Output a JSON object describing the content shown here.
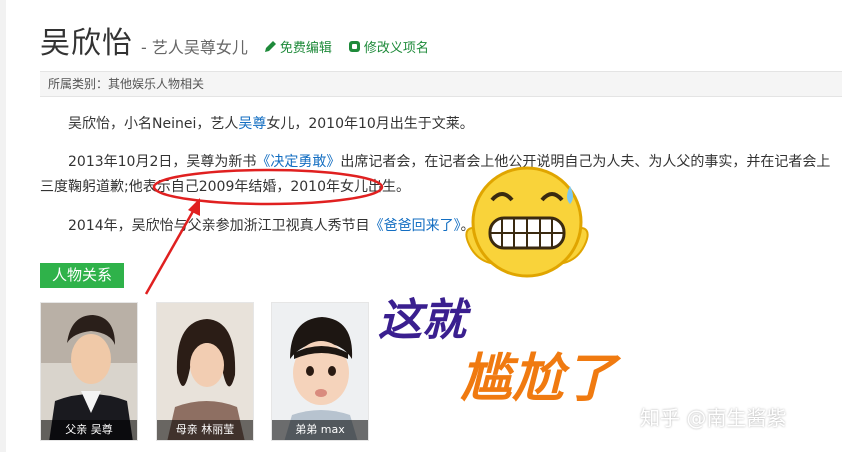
{
  "header": {
    "title": "吴欣怡",
    "subtitle": "- 艺人吴尊女儿",
    "edit_label": "免费编辑",
    "modify_label": "修改义项名"
  },
  "category": {
    "text": "所属类别：其他娱乐人物相关"
  },
  "paragraphs": {
    "p1": {
      "a": "吴欣怡，小名Neinei，艺人",
      "link": "吴尊",
      "b": "女儿，2010年10月出生于文莱。"
    },
    "p2": {
      "a": "2013年10月2日，吴尊为新书",
      "link": "《决定勇敢》",
      "b": "出席记者会，在记者会上他公开说明自己为人夫、为人父的事实，并在记者会上三度鞠躬道歉;他表示自己2009年结婚，2010年女儿出生。"
    },
    "p3": {
      "a": "2014年，吴欣怡与父亲参加浙江卫视真人秀节目",
      "link": "《爸爸回来了》",
      "b": "。"
    }
  },
  "section": {
    "label": "人物关系"
  },
  "relations": [
    {
      "caption": "父亲 吴尊"
    },
    {
      "caption": "母亲 林丽莹"
    },
    {
      "caption": "弟弟 max"
    }
  ],
  "overlay": {
    "line1": "这就",
    "line2": "尴尬了"
  },
  "watermark": {
    "text": "知乎 @南生酱紫"
  },
  "colors": {
    "accent_green": "#2fb24a",
    "link_blue": "#136ec2",
    "annotation_red": "#e02020"
  }
}
